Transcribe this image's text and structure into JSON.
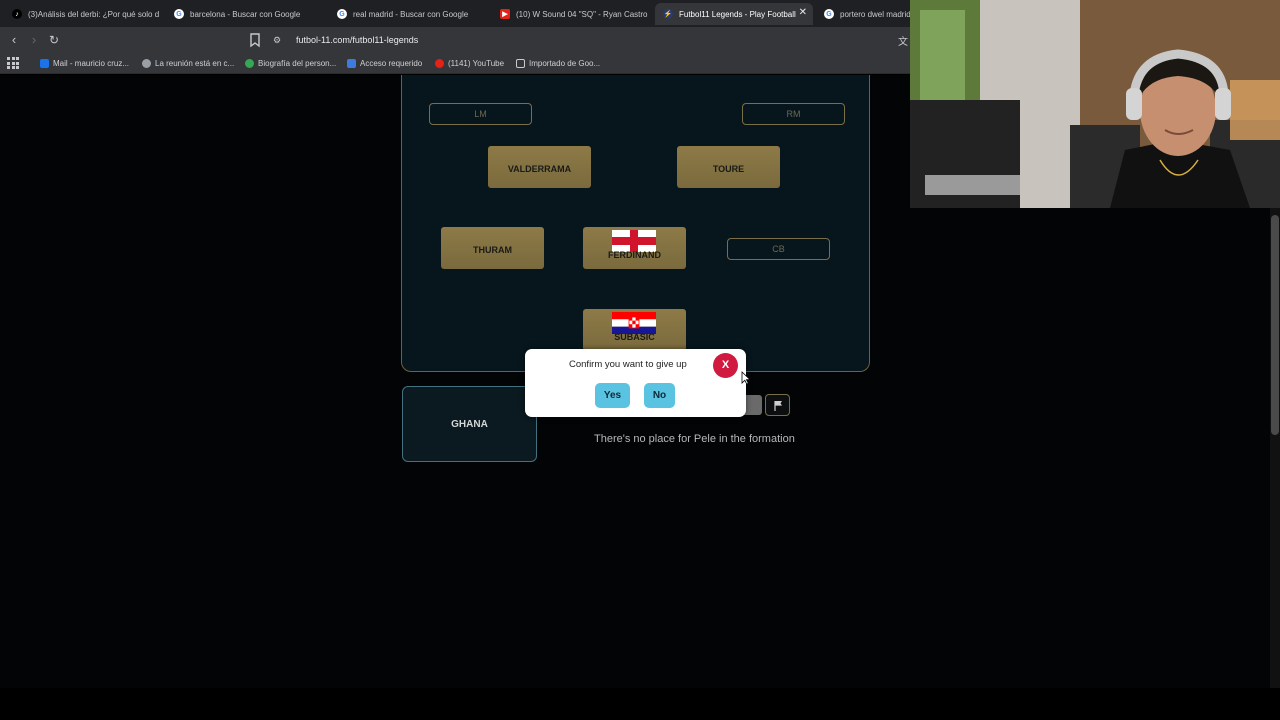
{
  "browser": {
    "tabs": [
      {
        "title": "(3)Análisis del derbi: ¿Por qué solo d",
        "icon": "tiktok-icon",
        "active": false
      },
      {
        "title": "barcelona - Buscar con Google",
        "icon": "google-icon",
        "active": false
      },
      {
        "title": "real madrid - Buscar con Google",
        "icon": "google-icon",
        "active": false
      },
      {
        "title": "(10) W Sound 04 \"SQ\" - Ryan Castro",
        "icon": "youtube-icon",
        "active": false
      },
      {
        "title": "Futbol11 Legends - Play Football",
        "icon": "futbol11-icon",
        "active": true
      },
      {
        "title": "portero dwel madrid",
        "icon": "google-icon",
        "active": false
      }
    ],
    "url": "futbol-11.com/futbol11-legends",
    "bookmarks": [
      {
        "label": "Mail - mauricio cruz...",
        "icon": "outlook-icon",
        "color": "#1a73e8"
      },
      {
        "label": "La reunión está en c...",
        "icon": "globe-icon",
        "color": "#9aa0a6"
      },
      {
        "label": "Biografía del person...",
        "icon": "google-icon",
        "color": "#34a853"
      },
      {
        "label": "Acceso requerido",
        "icon": "dropbox-icon",
        "color": "#3d7be0"
      },
      {
        "label": "(1141) YouTube",
        "icon": "youtube-icon",
        "color": "#e62117"
      },
      {
        "label": "Importado de Goo...",
        "icon": "folder-icon",
        "color": "#c9c9cc"
      }
    ]
  },
  "game": {
    "formation": {
      "empty_slots": {
        "lm": "LM",
        "rm": "RM",
        "cb": "CB"
      },
      "players": {
        "valderrama": "VALDERRAMA",
        "toure": "TOURE",
        "thuram": "THURAM",
        "ferdinand": "FERDINAND",
        "subasic": "SUBASIC"
      },
      "flags": {
        "ferdinand": "england-flag",
        "subasic": "croatia-flag"
      }
    },
    "team_card": "GHANA",
    "status_message": "There's no place for Pele in the formation"
  },
  "dialog": {
    "message": "Confirm you want to give up",
    "close_label": "X",
    "yes_label": "Yes",
    "no_label": "No"
  },
  "colors": {
    "card_gold": "#8d7a47",
    "dialog_button": "#59c3e1",
    "close_red": "#d01a40"
  }
}
